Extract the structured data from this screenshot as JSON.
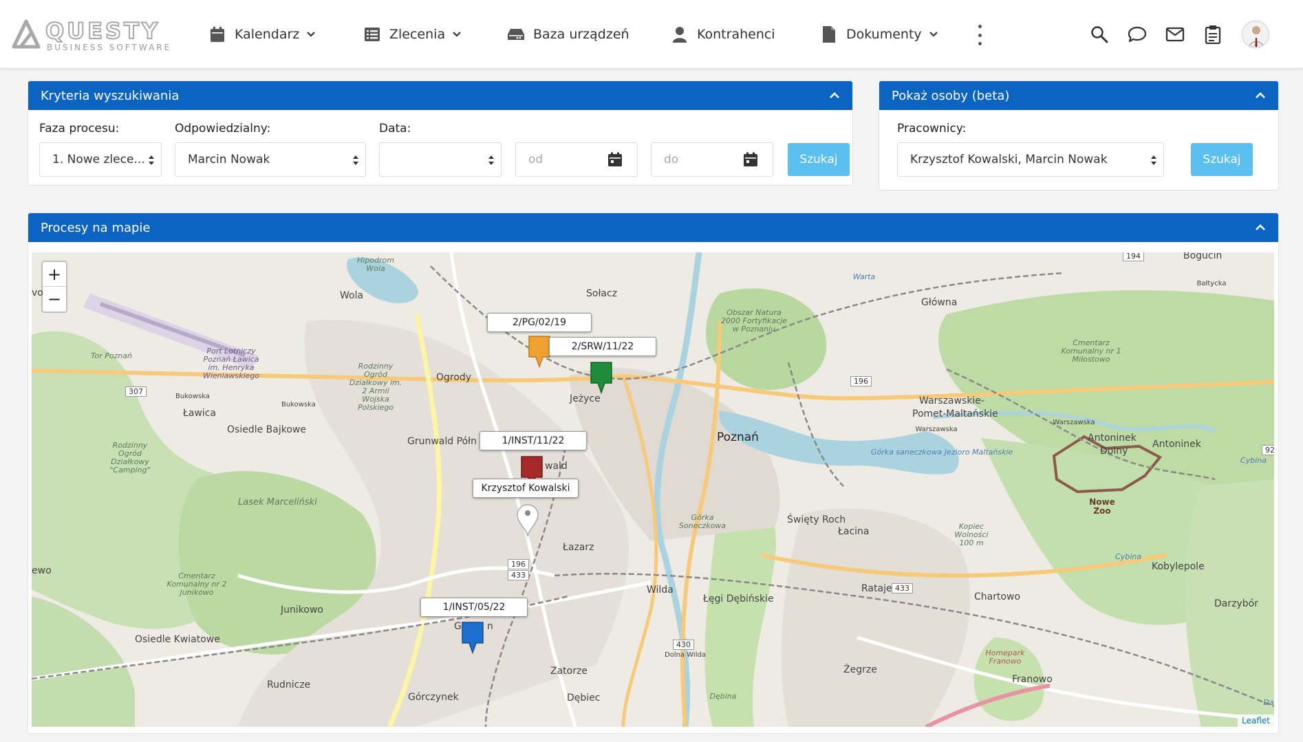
{
  "brand": {
    "name": "QUESTY",
    "tagline": "BUSINESS SOFTWARE",
    "accent": "#0b63c2"
  },
  "nav": {
    "calendar": "Kalendarz",
    "orders": "Zlecenia",
    "devices": "Baza urządzeń",
    "contractors": "Kontrahenci",
    "documents": "Dokumenty"
  },
  "search_criteria": {
    "title": "Kryteria wyszukiwania",
    "phase_label": "Faza procesu:",
    "phase_value": "1. Nowe zlece...",
    "responsible_label": "Odpowiedzialny:",
    "responsible_value": "Marcin Nowak",
    "date_label": "Data:",
    "date_value": "",
    "from_placeholder": "od",
    "to_placeholder": "do",
    "search_button": "Szukaj"
  },
  "people_panel": {
    "title": "Pokaż osoby (beta)",
    "employees_label": "Pracownicy:",
    "employees_value": "Krzysztof Kowalski, Marcin Nowak",
    "search_button": "Szukaj"
  },
  "map_panel": {
    "title": "Procesy na mapie",
    "zoom_in": "+",
    "zoom_out": "−",
    "attribution": "Leaflet",
    "markers": [
      {
        "label": "2/PG/02/19",
        "color": "#f0a030"
      },
      {
        "label": "2/SRW/11/22",
        "color": "#1e8c3a"
      },
      {
        "label": "1/INST/11/22",
        "color": "#a52a2a"
      },
      {
        "label": "Krzysztof Kowalski",
        "color": "#ffffff"
      },
      {
        "label": "1/INST/05/22",
        "color": "#1f6fd1"
      }
    ],
    "places": {
      "wola": "Wola",
      "solacz": "Sołacz",
      "ogrody": "Ogrody",
      "jezyce": "Jeżyce",
      "lawica": "Ławica",
      "osiedle_bajkowe": "Osiedle Bajkowe",
      "grunwald": "Grunwald Półn",
      "grunwald2": "wald",
      "poznan": "Poznań",
      "glowna": "Główna",
      "warszawskie": "Warszawskie-",
      "pomet": "Pomet-Maltańskie",
      "antoninek_dolny": "Antoninek",
      "dolny": "Dolny",
      "antoninek": "Antoninek",
      "swiety_roch": "Święty Roch",
      "lacina": "Łacina",
      "lazarz": "Łazarz",
      "wilda": "Wilda",
      "legi": "Łęgi Dębińskie",
      "rataje": "Rataje",
      "chartowo": "Chartowo",
      "kobylepole": "Kobylepole",
      "darzybor": "Darzybór",
      "junikowo": "Junikowo",
      "osiedle_kwiatowe": "Osiedle Kwiatowe",
      "rudnicze": "Rudnicze",
      "gorczynek": "Górczynek",
      "zatorze": "Zatorze",
      "debiec": "Dębiec",
      "zegrze": "Żegrze",
      "franowo": "Franowo",
      "bogucin": "Bogucin",
      "gu": "G",
      "gn": "n",
      "ewo": "ewo",
      "vo": "vo",
      "nowe_zoo": "Nowe Zoo",
      "lasek": "Lasek Marceliński",
      "hipodrom": "Hipodrom Wola",
      "port": "Port Lotniczy Poznań Ławica im. Henryka Wieniawskiego",
      "tor": "Tor Poznań",
      "cmentarz_milostowo": "Cmentarz Komunalny nr 1 Miłostowo",
      "cmentarz_junikowo": "Cmentarz Komunalny nr 2 Junikowo",
      "rodzinny_ogrod1": "Rodzinny Ogród Działkowy im. 2 Armii Wojska Polskiego",
      "rodzinny_ogrod2": "Rodzinny Ogród Działkowy \"Camping\"",
      "cytadela": "Obszar Natura 2000 Fortyfikacje w Poznaniu",
      "gorka": "Górka Soneczkowa",
      "jezioro": "Górka saneczkowa Jezioro Maltańskie",
      "kopiec": "Kopiec Wolności 100 m",
      "homepark": "Homepark Franowo",
      "debina": "Dębina",
      "bukowska1": "Bukowska",
      "bukowska2": "Bukowska",
      "warszawska1": "Warszawska",
      "warszawska2": "Warszawska",
      "warta": "Warta",
      "baltycka": "Bałtycka",
      "cybina": "Cybina",
      "cybina2": "Cybina",
      "dolna_wilda": "Dolna Wilda",
      "dw": "Da"
    },
    "roads": {
      "r307": "307",
      "r196a": "196",
      "r196b": "196",
      "r433a": "433",
      "r433b": "433",
      "r430": "430",
      "r194": "194",
      "r92": "92"
    }
  }
}
